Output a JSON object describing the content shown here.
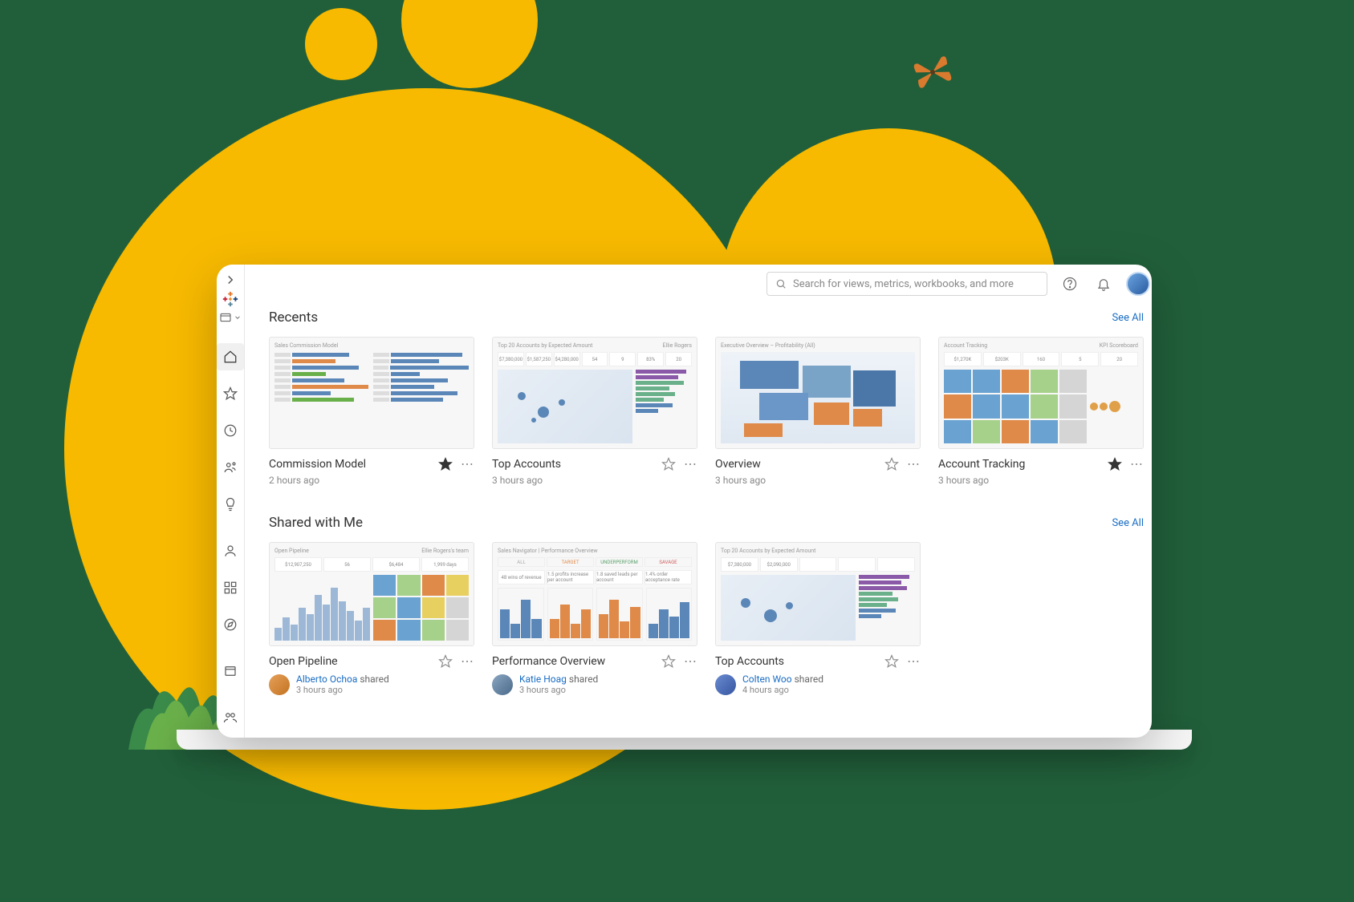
{
  "search": {
    "placeholder": "Search for views, metrics, workbooks, and more"
  },
  "sections": {
    "recents": {
      "title": "Recents",
      "see_all": "See All"
    },
    "shared": {
      "title": "Shared with Me",
      "see_all": "See All"
    }
  },
  "recents": [
    {
      "title": "Commission Model",
      "timestamp": "2 hours ago",
      "favorite": true,
      "thumb_label": "Sales Commission Model"
    },
    {
      "title": "Top Accounts",
      "timestamp": "3 hours ago",
      "favorite": false,
      "thumb_label": "Top 20 Accounts by Expected Amount",
      "thumb_owner": "Ellie Rogers",
      "metrics": [
        "$7,380,000",
        "$1,587,250",
        "$4,280,000",
        "54",
        "9",
        "83%",
        "20"
      ]
    },
    {
      "title": "Overview",
      "timestamp": "3 hours ago",
      "favorite": false,
      "thumb_label": "Executive Overview – Profitability (All)"
    },
    {
      "title": "Account Tracking",
      "timestamp": "3 hours ago",
      "favorite": true,
      "thumb_label": "Account Tracking",
      "thumb_sub": "KPI Scoreboard",
      "metrics": [
        "$1,270K",
        "$203K",
        "160",
        "5",
        "20"
      ]
    }
  ],
  "shared": [
    {
      "title": "Open Pipeline",
      "user": "Alberto Ochoa",
      "shared_word": "shared",
      "timestamp": "3 hours ago",
      "favorite": false,
      "thumb_label": "Open Pipeline",
      "thumb_owner": "Ellie Rogers's team",
      "metrics": [
        "$12,907,250",
        "56",
        "$6,484",
        "1,999 days"
      ]
    },
    {
      "title": "Performance Overview",
      "user": "Katie Hoag",
      "shared_word": "shared",
      "timestamp": "3 hours ago",
      "favorite": false,
      "thumb_label": "Sales Navigator | Performance Overview",
      "tabs": [
        "ALL",
        "TARGET",
        "UNDERPERFORM",
        "SAVAGE"
      ],
      "submetrics": [
        "48 wins of revenue",
        "1.5 profits increase per account",
        "1.8 saved leads per account",
        "1.4% order acceptance rate"
      ]
    },
    {
      "title": "Top Accounts",
      "user": "Colten Woo",
      "shared_word": "shared",
      "timestamp": "4 hours ago",
      "favorite": false,
      "thumb_label": "Top 20 Accounts by Expected Amount",
      "metrics": [
        "$7,380,000",
        "$2,090,000"
      ]
    }
  ]
}
